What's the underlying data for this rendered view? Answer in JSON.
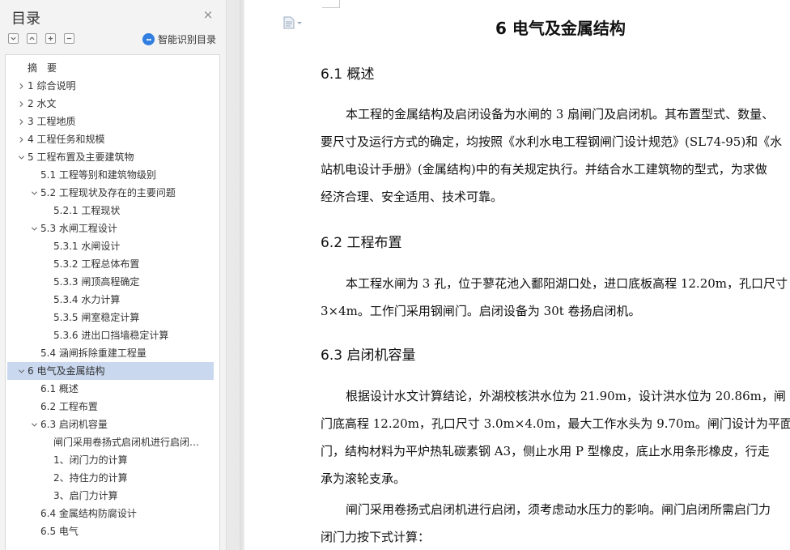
{
  "sidebar": {
    "title": "目录",
    "close_glyph": "×",
    "smart_toc_label": "智能识别目录",
    "tools": [
      "collapse-all-icon",
      "expand-up-icon",
      "add-level-icon",
      "remove-level-icon"
    ],
    "items": [
      {
        "label": "摘　要",
        "level": 0,
        "arrow": "none"
      },
      {
        "label": "1  综合说明",
        "level": 0,
        "arrow": "right"
      },
      {
        "label": "2  水文",
        "level": 0,
        "arrow": "right"
      },
      {
        "label": "3  工程地质",
        "level": 0,
        "arrow": "right"
      },
      {
        "label": "4  工程任务和规模",
        "level": 0,
        "arrow": "right"
      },
      {
        "label": "5  工程布置及主要建筑物",
        "level": 0,
        "arrow": "down"
      },
      {
        "label": "5.1  工程等别和建筑物级别",
        "level": 1,
        "arrow": "none"
      },
      {
        "label": "5.2  工程现状及存在的主要问题",
        "level": 1,
        "arrow": "down"
      },
      {
        "label": "5.2.1  工程现状",
        "level": 2,
        "arrow": "none"
      },
      {
        "label": "5.3  水闸工程设计",
        "level": 1,
        "arrow": "down"
      },
      {
        "label": "5.3.1 水闸设计",
        "level": 2,
        "arrow": "none"
      },
      {
        "label": "5.3.2  工程总体布置",
        "level": 2,
        "arrow": "none"
      },
      {
        "label": "5.3.3  闸顶高程确定",
        "level": 2,
        "arrow": "none"
      },
      {
        "label": "5.3.4  水力计算",
        "level": 2,
        "arrow": "none"
      },
      {
        "label": "5.3.5  闸室稳定计算",
        "level": 2,
        "arrow": "none"
      },
      {
        "label": "5.3.6  进出口挡墙稳定计算",
        "level": 2,
        "arrow": "none"
      },
      {
        "label": "5.4  涵闸拆除重建工程量",
        "level": 1,
        "arrow": "none"
      },
      {
        "label": "6  电气及金属结构",
        "level": 0,
        "arrow": "down",
        "selected": true
      },
      {
        "label": "6.1 概述",
        "level": 1,
        "arrow": "none"
      },
      {
        "label": "6.2 工程布置",
        "level": 1,
        "arrow": "none"
      },
      {
        "label": "6.3 启闭机容量",
        "level": 1,
        "arrow": "down"
      },
      {
        "label": "闸门采用卷扬式启闭机进行启闭，须考虑动水压力的影响。",
        "level": 2,
        "arrow": "none"
      },
      {
        "label": "1、闭门力的计算",
        "level": 2,
        "arrow": "none"
      },
      {
        "label": "2、持住力的计算",
        "level": 2,
        "arrow": "none"
      },
      {
        "label": "3、启门力计算",
        "level": 2,
        "arrow": "none"
      },
      {
        "label": "6.4 金属结构防腐设计",
        "level": 1,
        "arrow": "none"
      },
      {
        "label": "6.5 电气",
        "level": 1,
        "arrow": "none"
      }
    ]
  },
  "document": {
    "heading": "6  电气及金属结构",
    "sections": [
      {
        "heading": "6.1 概述",
        "lines": [
          "本工程的金属结构及启闭设备为水闸的 3 扇闸门及启闭机。其布置型式、数量、",
          "要尺寸及运行方式的确定，均按照《水利水电工程钢闸门设计规范》(SL74-95)和《水",
          "站机电设计手册》(金属结构)中的有关规定执行。并结合水工建筑物的型式，为求做",
          "经济合理、安全适用、技术可靠。"
        ]
      },
      {
        "heading": "6.2 工程布置",
        "lines": [
          "本工程水闸为 3 孔，位于蓼花池入鄱阳湖口处，进口底板高程 12.20m，孔口尺寸",
          "3×4m。工作门采用钢闸门。启闭设备为 30t 卷扬启闭机。"
        ]
      },
      {
        "heading": "6.3 启闭机容量",
        "lines": [
          "根据设计水文计算结论，外湖校核洪水位为 21.90m，设计洪水位为 20.86m，闸",
          "门底高程 12.20m，孔口尺寸 3.0m×4.0m，最大工作水头为 9.70m。闸门设计为平面钢",
          "门，结构材料为平炉热轧碳素钢 A3，侧止水用 P 型橡皮，底止水用条形橡皮，行走",
          "承为滚轮支承。"
        ],
        "lines2": [
          "闸门采用卷扬式启闭机进行启闭，须考虑动水压力的影响。闸门启闭所需启门力",
          "闭门力按下式计算："
        ]
      }
    ]
  }
}
